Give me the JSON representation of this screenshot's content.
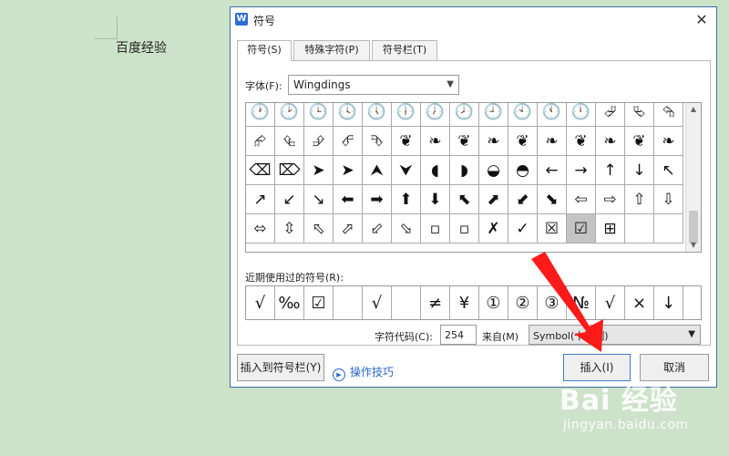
{
  "document": {
    "text": "百度经验"
  },
  "dialog": {
    "title": "符号",
    "app_icon_letter": "W",
    "close_glyph": "✕",
    "tabs": [
      {
        "label": "符号(S)"
      },
      {
        "label": "特殊字符(P)"
      },
      {
        "label": "符号栏(T)"
      }
    ],
    "font": {
      "label": "字体(F):",
      "value": "Wingdings"
    },
    "symbol_rows": [
      [
        "🕐",
        "🕑",
        "🕒",
        "🕓",
        "🕔",
        "🕕",
        "🕖",
        "🕗",
        "🕘",
        "🕙",
        "🕚",
        "🕛",
        "⮰",
        "⮱",
        "⮲"
      ],
      [
        "⮳",
        "⮴",
        "⮵",
        "⮶",
        "⮷",
        "❦",
        "❧",
        "❦",
        "❧",
        "❦",
        "❧",
        "❦",
        "❧",
        "❦",
        "❧"
      ],
      [
        "⌫",
        "⌦",
        "➤",
        "➤",
        "⮝",
        "⮟",
        "◖",
        "◗",
        "◒",
        "◓",
        "←",
        "→",
        "↑",
        "↓",
        "↖"
      ],
      [
        "↗",
        "↙",
        "↘",
        "⬅",
        "➡",
        "⬆",
        "⬇",
        "⬉",
        "⬈",
        "⬋",
        "⬊",
        "⇦",
        "⇨",
        "⇧",
        "⇩"
      ],
      [
        "⬄",
        "⇳",
        "⬁",
        "⬀",
        "⬃",
        "⬂",
        "▫",
        "▫",
        "✗",
        "✓",
        "☒",
        "☑",
        "⊞",
        "",
        ""
      ]
    ],
    "selected_symbol": {
      "row": 4,
      "col": 11
    },
    "recent_label": "近期使用过的符号(R):",
    "recent_symbols": [
      "√",
      "‰",
      "☑",
      "",
      "√",
      "",
      "≠",
      "¥",
      "①",
      "②",
      "③",
      "№",
      "√",
      "×",
      "↓"
    ],
    "char_code": {
      "label": "字符代码(C):",
      "value": "254"
    },
    "from": {
      "label": "来自(M)",
      "value": "Symbol(十进制)"
    },
    "insert_to_bar_button": "插入到符号栏(Y)",
    "tips_link": "操作技巧",
    "insert_button": "插入(I)",
    "cancel_button": "取消"
  },
  "watermark": {
    "logo": "Bai 经验",
    "url": "jingyan.baidu.com"
  },
  "annotation": {
    "color": "#ff1a1a"
  }
}
